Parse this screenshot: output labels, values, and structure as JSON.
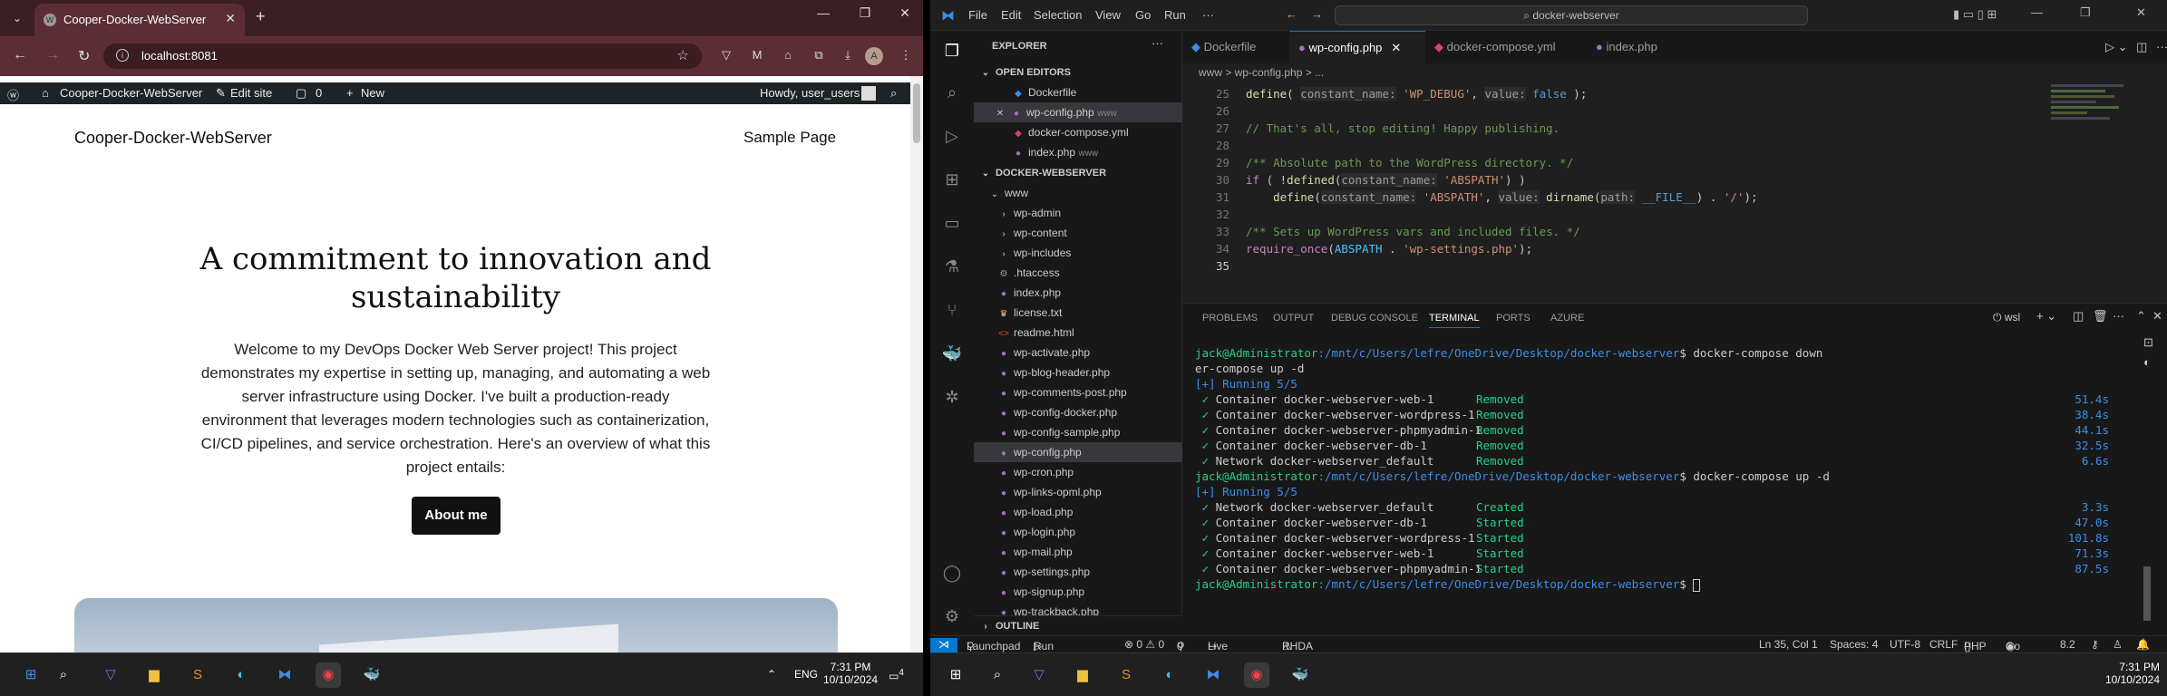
{
  "browser": {
    "tab_title": "Cooper-Docker-WebServer",
    "url": "localhost:8081",
    "avatar": "A"
  },
  "wp_admin_bar": {
    "site": "Cooper-Docker-WebServer",
    "edit": "Edit site",
    "comments": "0",
    "new": "New",
    "howdy": "Howdy, user_users"
  },
  "page": {
    "site_title": "Cooper-Docker-WebServer",
    "nav_link": "Sample Page",
    "heading": "A commitment to innovation and sustainability",
    "intro": "Welcome to my DevOps Docker Web Server project! This project demonstrates my expertise in setting up, managing, and automating a web server infrastructure using Docker. I've built a production-ready environment that leverages modern technologies such as containerization, CI/CD pipelines, and service orchestration. Here's an overview of what this project entails:",
    "button": "About me"
  },
  "vscode": {
    "menu": [
      "File",
      "Edit",
      "Selection",
      "View",
      "Go",
      "Run",
      "···"
    ],
    "search": "docker-webserver",
    "explorer_title": "EXPLORER",
    "open_editors_title": "OPEN EDITORS",
    "open_editors": [
      {
        "name": "Dockerfile",
        "suffix": ""
      },
      {
        "name": "wp-config.php",
        "suffix": "www"
      },
      {
        "name": "docker-compose.yml",
        "suffix": ""
      },
      {
        "name": "index.php",
        "suffix": "www"
      }
    ],
    "folder_title": "DOCKER-WEBSERVER",
    "tree": [
      "www",
      "wp-admin",
      "wp-content",
      "wp-includes",
      ".htaccess",
      "index.php",
      "license.txt",
      "readme.html",
      "wp-activate.php",
      "wp-blog-header.php",
      "wp-comments-post.php",
      "wp-config-docker.php",
      "wp-config-sample.php",
      "wp-config.php",
      "wp-cron.php",
      "wp-links-opml.php",
      "wp-load.php",
      "wp-login.php",
      "wp-mail.php",
      "wp-settings.php",
      "wp-signup.php",
      "wp-trackback.php"
    ],
    "outline": "OUTLINE",
    "tabs": [
      "Dockerfile",
      "wp-config.php",
      "docker-compose.yml",
      "index.php"
    ],
    "breadcrumb": "www  >  wp-config.php  >  ...",
    "code": [
      {
        "n": "25",
        "t": "define( constant_name: 'WP_DEBUG', value: false );"
      },
      {
        "n": "26",
        "t": ""
      },
      {
        "n": "27",
        "t": "// That's all, stop editing! Happy publishing."
      },
      {
        "n": "28",
        "t": ""
      },
      {
        "n": "29",
        "t": "/** Absolute path to the WordPress directory. */"
      },
      {
        "n": "30",
        "t": "if ( !defined(constant_name: 'ABSPATH') )"
      },
      {
        "n": "31",
        "t": "    define(constant_name: 'ABSPATH', value: dirname(path: __FILE__) . '/');"
      },
      {
        "n": "32",
        "t": ""
      },
      {
        "n": "33",
        "t": "/** Sets up WordPress vars and included files. */"
      },
      {
        "n": "34",
        "t": "require_once(ABSPATH . 'wp-settings.php');"
      },
      {
        "n": "35",
        "t": ""
      }
    ],
    "panel_tabs": [
      "PROBLEMS",
      "OUTPUT",
      "DEBUG CONSOLE",
      "TERMINAL",
      "PORTS",
      "AZURE"
    ],
    "terminal_label": "wsl",
    "prompt": "jack@Administrator",
    "cwd": ":/mnt/c/Users/lefre/OneDrive/Desktop/docker-webserver",
    "cmd1": "$ docker-compose down",
    "cmd1_wrap": "er-compose up -d",
    "running": "[+] Running 5/5",
    "down_rows": [
      {
        "name": "Container docker-webserver-web-1",
        "status": "Removed",
        "time": "51.4s"
      },
      {
        "name": "Container docker-webserver-wordpress-1",
        "status": "Removed",
        "time": "38.4s"
      },
      {
        "name": "Container docker-webserver-phpmyadmin-1",
        "status": "Removed",
        "time": "44.1s"
      },
      {
        "name": "Container docker-webserver-db-1",
        "status": "Removed",
        "time": "32.5s"
      },
      {
        "name": "Network docker-webserver_default",
        "status": "Removed",
        "time": "6.6s"
      }
    ],
    "cmd2": "$ docker-compose up -d",
    "up_rows": [
      {
        "name": "Network docker-webserver_default",
        "status": "Created",
        "time": "3.3s"
      },
      {
        "name": "Container docker-webserver-db-1",
        "status": "Started",
        "time": "47.0s"
      },
      {
        "name": "Container docker-webserver-wordpress-1",
        "status": "Started",
        "time": "101.8s"
      },
      {
        "name": "Container docker-webserver-web-1",
        "status": "Started",
        "time": "71.3s"
      },
      {
        "name": "Container docker-webserver-phpmyadmin-1",
        "status": "Started",
        "time": "87.5s"
      }
    ],
    "cmd3": "$ ",
    "status": {
      "launchpad": "Launchpad",
      "testcases": "Run Testcases",
      "problems": "⊗ 0 ⚠ 0",
      "ports": "0",
      "liveshare": "Live Share",
      "rhda": "RHDA analysis has failed",
      "pos": "Ln 35, Col 1",
      "spaces": "Spaces: 4",
      "enc": "UTF-8",
      "eol": "CRLF",
      "lang": "PHP",
      "golive": "Go Live",
      "ver": "8.2"
    }
  },
  "taskbar": {
    "lang": "ENG",
    "time": "7:31 PM",
    "date": "10/10/2024",
    "notif": "4"
  }
}
